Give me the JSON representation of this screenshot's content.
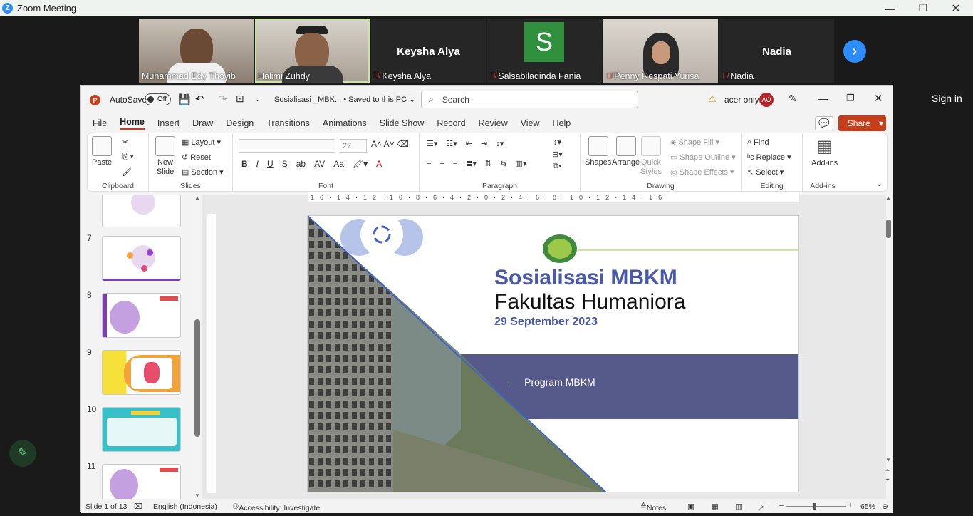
{
  "zoom": {
    "title": "Zoom Meeting"
  },
  "participants": [
    {
      "name": "Muhammad Edy Thoyib",
      "big": "",
      "muted": false
    },
    {
      "name": "Halimi Zuhdy",
      "big": "",
      "muted": false
    },
    {
      "name": "Keysha Alya",
      "big": "Keysha Alya",
      "muted": true
    },
    {
      "name": "Salsabiladinda Fania",
      "big": "S",
      "muted": true
    },
    {
      "name": "Penny Respati Yurisa",
      "big": "",
      "muted": true
    },
    {
      "name": "Nadia",
      "big": "Nadia",
      "muted": true
    }
  ],
  "signin": "Sign in",
  "ppt": {
    "autosave": "AutoSave",
    "autosave_state": "Off",
    "filename": "Sosialisasi _MBK... • Saved to this PC ⌄",
    "search_placeholder": "Search",
    "account": "acer only",
    "avatar": "AO",
    "share": "Share",
    "menu": [
      "File",
      "Home",
      "Insert",
      "Draw",
      "Design",
      "Transitions",
      "Animations",
      "Slide Show",
      "Record",
      "Review",
      "View",
      "Help"
    ],
    "ribbon": {
      "paste": "Paste",
      "clipboard": "Clipboard",
      "new_slide": "New Slide",
      "layout": "Layout",
      "reset": "Reset",
      "section": "Section",
      "slides": "Slides",
      "font_size": "27",
      "font": "Font",
      "paragraph": "Paragraph",
      "shapes": "Shapes",
      "arrange": "Arrange",
      "quick_styles": "Quick Styles",
      "shape_fill": "Shape Fill",
      "shape_outline": "Shape Outline",
      "shape_effects": "Shape Effects",
      "drawing": "Drawing",
      "find": "Find",
      "replace": "Replace",
      "select": "Select",
      "editing": "Editing",
      "addins": "Add-ins",
      "addins_group": "Add-ins"
    },
    "thumb_numbers": [
      "7",
      "8",
      "9",
      "10",
      "11"
    ],
    "ruler_h": "16·14·12·10·8·6·4·2·0·2·4·6·8·10·12·14·16",
    "slide": {
      "title1": "Sosialisasi MBKM",
      "title2": "Fakultas Humaniora",
      "date": "29 September 2023",
      "bullet": "Program MBKM"
    },
    "status": {
      "slide_of": "Slide 1 of 13",
      "language": "English (Indonesia)",
      "accessibility": "Accessibility: Investigate",
      "notes": "Notes",
      "zoom": "65%"
    }
  }
}
